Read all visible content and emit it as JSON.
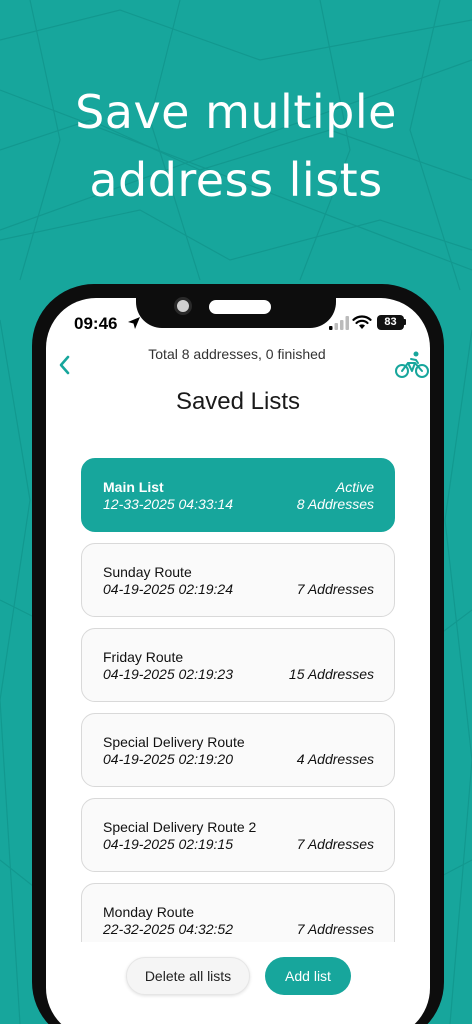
{
  "headline": {
    "line1": "Save multiple",
    "line2": "address lists"
  },
  "status_bar": {
    "time": "09:46",
    "battery": "83"
  },
  "header": {
    "summary": "Total 8 addresses, 0 finished",
    "title": "Saved Lists"
  },
  "lists": [
    {
      "name": "Main List",
      "date": "12-33-2025 04:33:14",
      "status": "Active",
      "count": "8 Addresses",
      "active": true
    },
    {
      "name": "Sunday Route",
      "date": "04-19-2025 02:19:24",
      "status": "",
      "count": "7 Addresses",
      "active": false
    },
    {
      "name": "Friday Route",
      "date": "04-19-2025 02:19:23",
      "status": "",
      "count": "15 Addresses",
      "active": false
    },
    {
      "name": "Special Delivery Route",
      "date": "04-19-2025 02:19:20",
      "status": "",
      "count": "4 Addresses",
      "active": false
    },
    {
      "name": "Special Delivery Route 2",
      "date": "04-19-2025 02:19:15",
      "status": "",
      "count": "7 Addresses",
      "active": false
    },
    {
      "name": "Monday Route",
      "date": "22-32-2025 04:32:52",
      "status": "",
      "count": "7 Addresses",
      "active": false
    }
  ],
  "actions": {
    "delete_all": "Delete all lists",
    "add": "Add list"
  },
  "colors": {
    "accent": "#17a69c",
    "card_bg": "#fafafa",
    "card_border": "#d9d9d9"
  },
  "icons": {
    "back": "chevron-left-icon",
    "mode": "bicycle-icon",
    "location": "location-arrow-icon",
    "signal": "cellular-signal-icon",
    "wifi": "wifi-icon",
    "battery": "battery-icon"
  }
}
